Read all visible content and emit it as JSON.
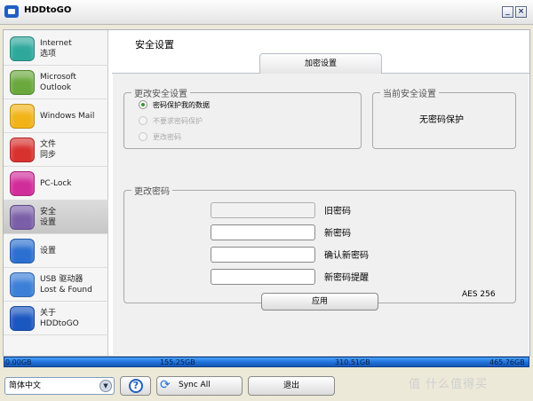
{
  "window": {
    "title": "HDDtoGO",
    "controls": {
      "minimize": "_",
      "close": "×"
    }
  },
  "sidebar": {
    "items": [
      {
        "label": "Internet\n选项",
        "icon": "internet-icon",
        "color": "#2fa89c",
        "active": false
      },
      {
        "label": "Microsoft\nOutlook",
        "icon": "outlook-icon",
        "color": "#6aa83c",
        "active": false
      },
      {
        "label": "Windows Mail",
        "icon": "windows-mail-icon",
        "color": "#f2b318",
        "active": false
      },
      {
        "label": "文件\n同步",
        "icon": "file-sync-icon",
        "color": "#d8312e",
        "active": false
      },
      {
        "label": "PC-Lock",
        "icon": "pc-lock-icon",
        "color": "#d02c9a",
        "active": false
      },
      {
        "label": "安全\n设置",
        "icon": "security-lock-icon",
        "color": "#7a5fa8",
        "active": true
      },
      {
        "label": "设置",
        "icon": "settings-gear-icon",
        "color": "#2b6fd0",
        "active": false
      },
      {
        "label": "USB 驱动器\nLost & Found",
        "icon": "usb-lost-found-icon",
        "color": "#3b7fd8",
        "active": false
      },
      {
        "label": "关于\nHDDtoGO",
        "icon": "about-icon",
        "color": "#1b57c0",
        "active": false
      }
    ]
  },
  "main": {
    "title": "安全设置",
    "tab": "加密设置",
    "change_security": {
      "legend": "更改安全设置",
      "options": [
        {
          "label": "密码保护我的数据",
          "selected": true,
          "enabled": true
        },
        {
          "label": "不要求密码保护",
          "selected": false,
          "enabled": false
        },
        {
          "label": "更改密码",
          "selected": false,
          "enabled": false
        }
      ]
    },
    "current_security": {
      "legend": "当前安全设置",
      "value": "无密码保护"
    },
    "change_password": {
      "legend": "更改密码",
      "fields": [
        {
          "label": "旧密码",
          "value": ""
        },
        {
          "label": "新密码",
          "value": ""
        },
        {
          "label": "确认新密码",
          "value": ""
        },
        {
          "label": "新密码提醒",
          "value": ""
        }
      ],
      "encryption": "AES 256",
      "apply_label": "应用"
    }
  },
  "storage": {
    "labels": [
      "0.00GB",
      "155.25GB",
      "310.51GB",
      "465.76GB"
    ],
    "used_fraction": 1.0
  },
  "footer": {
    "language": "简体中文",
    "help_label": "?",
    "sync_label": "Sync All",
    "exit_label": "退出",
    "watermark": "值 什么值得买"
  }
}
